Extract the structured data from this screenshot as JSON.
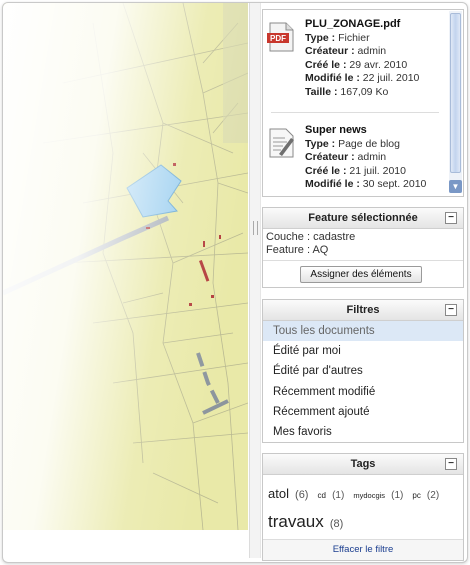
{
  "documents": [
    {
      "icon": "pdf-file-icon",
      "icon_label": "PDF",
      "title": "PLU_ZONAGE.pdf",
      "type_label": "Type :",
      "type": "Fichier",
      "creator_label": "Créateur :",
      "creator": "admin",
      "created_label": "Créé le :",
      "created": "29 avr. 2010",
      "modified_label": "Modifié le :",
      "modified": "22 juil. 2010",
      "size_label": "Taille :",
      "size": "167,09 Ko"
    },
    {
      "icon": "blog-page-icon",
      "title": "Super news",
      "type_label": "Type :",
      "type": "Page de blog",
      "creator_label": "Créateur :",
      "creator": "admin",
      "created_label": "Créé le :",
      "created": "21 juil. 2010",
      "modified_label": "Modifié le :",
      "modified": "30 sept. 2010"
    }
  ],
  "feature_panel": {
    "title": "Feature sélectionnée",
    "collapse_symbol": "−",
    "layer": "Couche : cadastre",
    "feature": "Feature : AQ",
    "assign_button": "Assigner des éléments"
  },
  "filters_panel": {
    "title": "Filtres",
    "collapse_symbol": "−",
    "items": [
      "Tous les documents",
      "Édité par moi",
      "Édité par d'autres",
      "Récemment modifié",
      "Récemment ajouté",
      "Mes favoris"
    ],
    "selected_index": 0
  },
  "tags_panel": {
    "title": "Tags",
    "collapse_symbol": "−",
    "tags": [
      {
        "name": "atol",
        "count": "(6)"
      },
      {
        "name": "cd",
        "count": "(1)"
      },
      {
        "name": "mydocgis",
        "count": "(1)"
      },
      {
        "name": "pc",
        "count": "(2)"
      },
      {
        "name": "travaux",
        "count": "(8)"
      }
    ],
    "clear_link": "Effacer le filtre"
  },
  "scrollbar": {
    "down_symbol": "▼"
  },
  "colors": {
    "map_fill": "#e9e9a8",
    "parcel_line": "#b7b78f",
    "selected_parcel": "#9ed0f0",
    "road": "#9aa6b0",
    "filter_selected_bg": "#dce8f6",
    "link": "#1a3d8f"
  }
}
